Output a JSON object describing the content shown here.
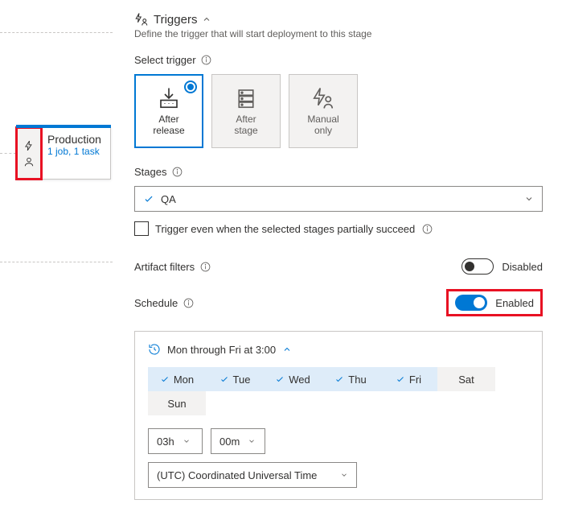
{
  "pipeline": {
    "stage_name": "Production",
    "stage_sub": "1 job, 1 task"
  },
  "panel": {
    "title": "Triggers",
    "subtitle": "Define the trigger that will start deployment to this stage",
    "select_trigger_label": "Select trigger",
    "options": {
      "after_release": "After\nrelease",
      "after_stage": "After\nstage",
      "manual_only": "Manual\nonly"
    },
    "stages_label": "Stages",
    "selected_stage": "QA",
    "partial_succeed_label": "Trigger even when the selected stages partially succeed",
    "artifact_filters_label": "Artifact filters",
    "artifact_filters_state": "Disabled",
    "schedule_label": "Schedule",
    "schedule_state": "Enabled",
    "schedule": {
      "summary": "Mon through Fri at 3:00",
      "days": [
        "Mon",
        "Tue",
        "Wed",
        "Thu",
        "Fri",
        "Sat",
        "Sun"
      ],
      "active_days": [
        "Mon",
        "Tue",
        "Wed",
        "Thu",
        "Fri"
      ],
      "hour": "03h",
      "minute": "00m",
      "timezone": "(UTC) Coordinated Universal Time"
    }
  }
}
